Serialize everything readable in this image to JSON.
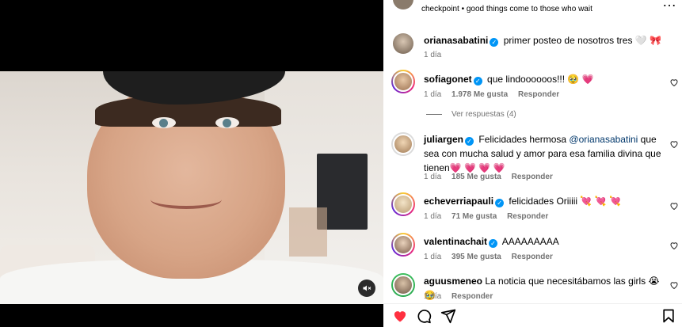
{
  "header": {
    "caption": "checkpoint • good things come to those who wait"
  },
  "post": {
    "author": "orianasabatini",
    "text": "primer posteo de nosotros tres 🤍 🎀",
    "time": "1 día"
  },
  "comments": [
    {
      "username": "sofiagonet",
      "text": "que lindoooooos!!! 🥹 💗",
      "time": "1 día",
      "likes": "1.978 Me gusta",
      "reply": "Responder",
      "view_replies": "Ver respuestas (4)"
    },
    {
      "username": "juliargen",
      "text_before": "Felicidades hermosa ",
      "mention": "@orianasabatini",
      "text_after": " que sea con mucha salud y amor para esa familia divina que tienen💗 💗 💗 💗",
      "time": "1 día",
      "likes": "185 Me gusta",
      "reply": "Responder"
    },
    {
      "username": "echeverriapauli",
      "text": "felicidades Oriiiii 💘 💘 💘",
      "time": "1 día",
      "likes": "71 Me gusta",
      "reply": "Responder"
    },
    {
      "username": "valentinachait",
      "text": "AAAAAAAAA",
      "time": "1 día",
      "likes": "395 Me gusta",
      "reply": "Responder"
    },
    {
      "username": "aguusmeneo",
      "text": "La noticia que necesitábamos las girls 😭 🥹",
      "time": "1 día",
      "reply": "Responder"
    }
  ],
  "icons": {
    "like": "heart-icon",
    "comment": "comment-icon",
    "share": "share-icon",
    "save": "bookmark-icon",
    "more": "more-options-icon",
    "mute": "muted-speaker-icon"
  },
  "colors": {
    "like_active": "#ff3040",
    "verified": "#0095f6",
    "muted_text": "#737373",
    "mention": "#00376b"
  }
}
